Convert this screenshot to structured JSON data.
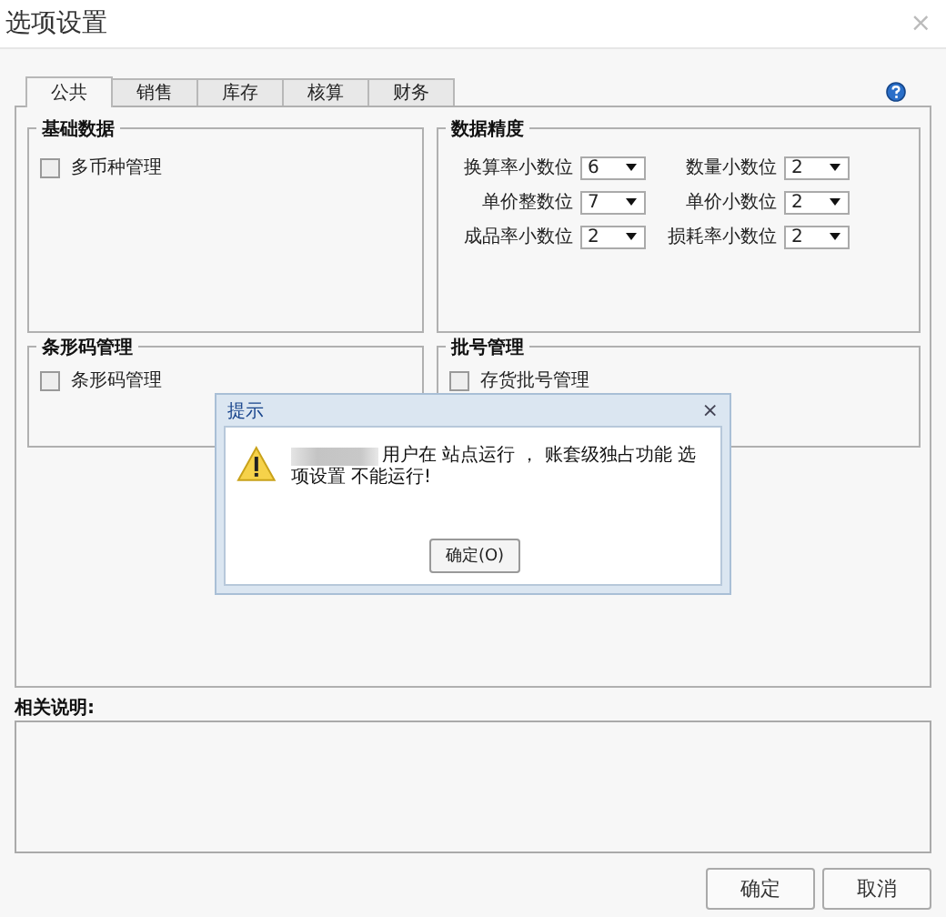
{
  "window": {
    "title": "选项设置",
    "close": "×"
  },
  "tabs": [
    {
      "label": "公共",
      "selected": true
    },
    {
      "label": "销售",
      "selected": false
    },
    {
      "label": "库存",
      "selected": false
    },
    {
      "label": "核算",
      "selected": false
    },
    {
      "label": "财务",
      "selected": false
    }
  ],
  "groups": [
    {
      "title": "基础数据",
      "kind": "checks",
      "items": [
        {
          "label": "多币种管理",
          "checked": false
        }
      ]
    },
    {
      "title": "数据精度",
      "kind": "selects",
      "fields": [
        {
          "label": "换算率小数位",
          "value": "6"
        },
        {
          "label": "数量小数位",
          "value": "2"
        },
        {
          "label": "单价整数位",
          "value": "7"
        },
        {
          "label": "单价小数位",
          "value": "2"
        },
        {
          "label": "成品率小数位",
          "value": "2"
        },
        {
          "label": "损耗率小数位",
          "value": "2"
        }
      ]
    },
    {
      "title": "条形码管理",
      "kind": "checks",
      "items": [
        {
          "label": "条形码管理",
          "checked": false
        }
      ]
    },
    {
      "title": "批号管理",
      "kind": "checks",
      "items": [
        {
          "label": "存货批号管理",
          "checked": false
        }
      ]
    }
  ],
  "notes": {
    "label": "相关说明:"
  },
  "buttons": [
    "确定",
    "取消"
  ],
  "dialog": {
    "title": "提示",
    "close": "×",
    "message": "用户在 站点运行 ， 账套级独占功能 选项设置 不能运行!",
    "button": "确定(O)"
  }
}
